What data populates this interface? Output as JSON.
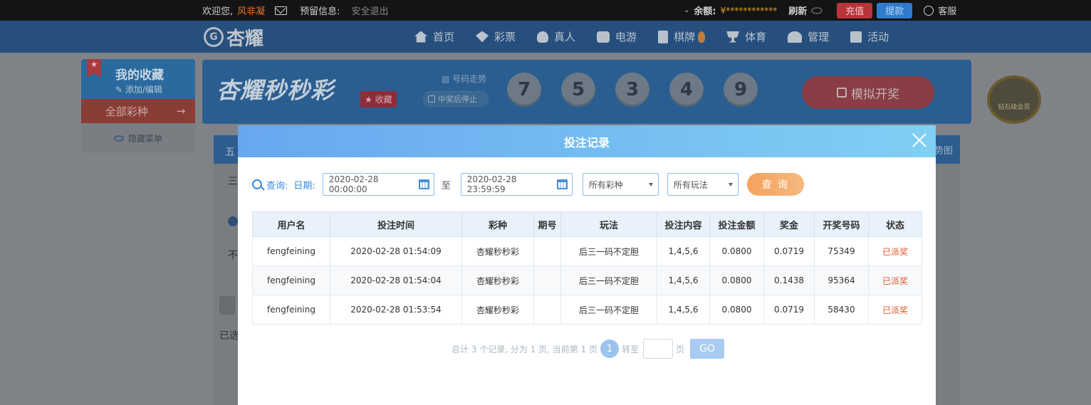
{
  "topbar": {
    "welcome": "欢迎您,",
    "username": "风非凝",
    "reserved_info": "预留信息:",
    "logout": "安全退出",
    "balance_label": "余额:",
    "balance_value": "¥************",
    "refresh": "刷新",
    "recharge": "充值",
    "withdraw": "提款",
    "service": "客服"
  },
  "nav": {
    "logo_text": "杏耀",
    "items": [
      {
        "label": "首页",
        "icon": "home-icon"
      },
      {
        "label": "彩票",
        "icon": "lottery-icon"
      },
      {
        "label": "真人",
        "icon": "live-dealer-icon"
      },
      {
        "label": "电游",
        "icon": "slot-game-icon"
      },
      {
        "label": "棋牌",
        "icon": "cards-icon"
      },
      {
        "label": "体育",
        "icon": "trophy-icon"
      },
      {
        "label": "管理",
        "icon": "users-icon"
      },
      {
        "label": "活动",
        "icon": "gift-icon"
      }
    ]
  },
  "favorites": {
    "title": "我的收藏",
    "edit": "添加/编辑",
    "all_games": "全部彩种",
    "hide_menu": "隐藏菜单"
  },
  "game": {
    "title": "杏耀秒秒彩",
    "fav_tag": "收藏",
    "trend": "号码走势",
    "stop_on_win": "中奖后停止",
    "balls": [
      "7",
      "5",
      "3",
      "4",
      "9"
    ],
    "simulate": "模拟开奖",
    "vip": "钻石级会员"
  },
  "background": {
    "strip_left": "五",
    "row1": "三",
    "row3": "不",
    "row5": "已选",
    "trend_right": "势图"
  },
  "modal": {
    "title": "投注记录",
    "query_label": "查询:",
    "date_label": "日期:",
    "date_from": "2020-02-28 00:00:00",
    "to": "至",
    "date_to": "2020-02-28 23:59:59",
    "lottery_select": "所有彩种",
    "play_select": "所有玩法",
    "query_button": "查 询",
    "columns": [
      "用户名",
      "投注时间",
      "彩种",
      "期号",
      "玩法",
      "投注内容",
      "投注金额",
      "奖金",
      "开奖号码",
      "状态"
    ],
    "rows": [
      {
        "user": "fengfeining",
        "time": "2020-02-28 01:54:09",
        "lottery": "杏耀秒秒彩",
        "issue": "",
        "play": "后三一码不定胆",
        "content": "1,4,5,6",
        "amount": "0.0800",
        "bonus": "0.0719",
        "draw": "75349",
        "status": "已派奖"
      },
      {
        "user": "fengfeining",
        "time": "2020-02-28 01:54:04",
        "lottery": "杏耀秒秒彩",
        "issue": "",
        "play": "后三一码不定胆",
        "content": "1,4,5,6",
        "amount": "0.0800",
        "bonus": "0.1438",
        "draw": "95364",
        "status": "已派奖"
      },
      {
        "user": "fengfeining",
        "time": "2020-02-28 01:53:54",
        "lottery": "杏耀秒秒彩",
        "issue": "",
        "play": "后三一码不定胆",
        "content": "1,4,5,6",
        "amount": "0.0800",
        "bonus": "0.0719",
        "draw": "58430",
        "status": "已派奖"
      }
    ],
    "pager": {
      "summary": "总计 3 个记录, 分为 1 页, 当前第 1 页",
      "current": "1",
      "goto": "转至",
      "page_unit": "页",
      "go": "GO"
    }
  },
  "colors": {
    "modal_header_start": "#68a7ef",
    "modal_header_end": "#7fd0f4",
    "status_paid": "#e05a2b",
    "query_button": "#f3a25d"
  }
}
